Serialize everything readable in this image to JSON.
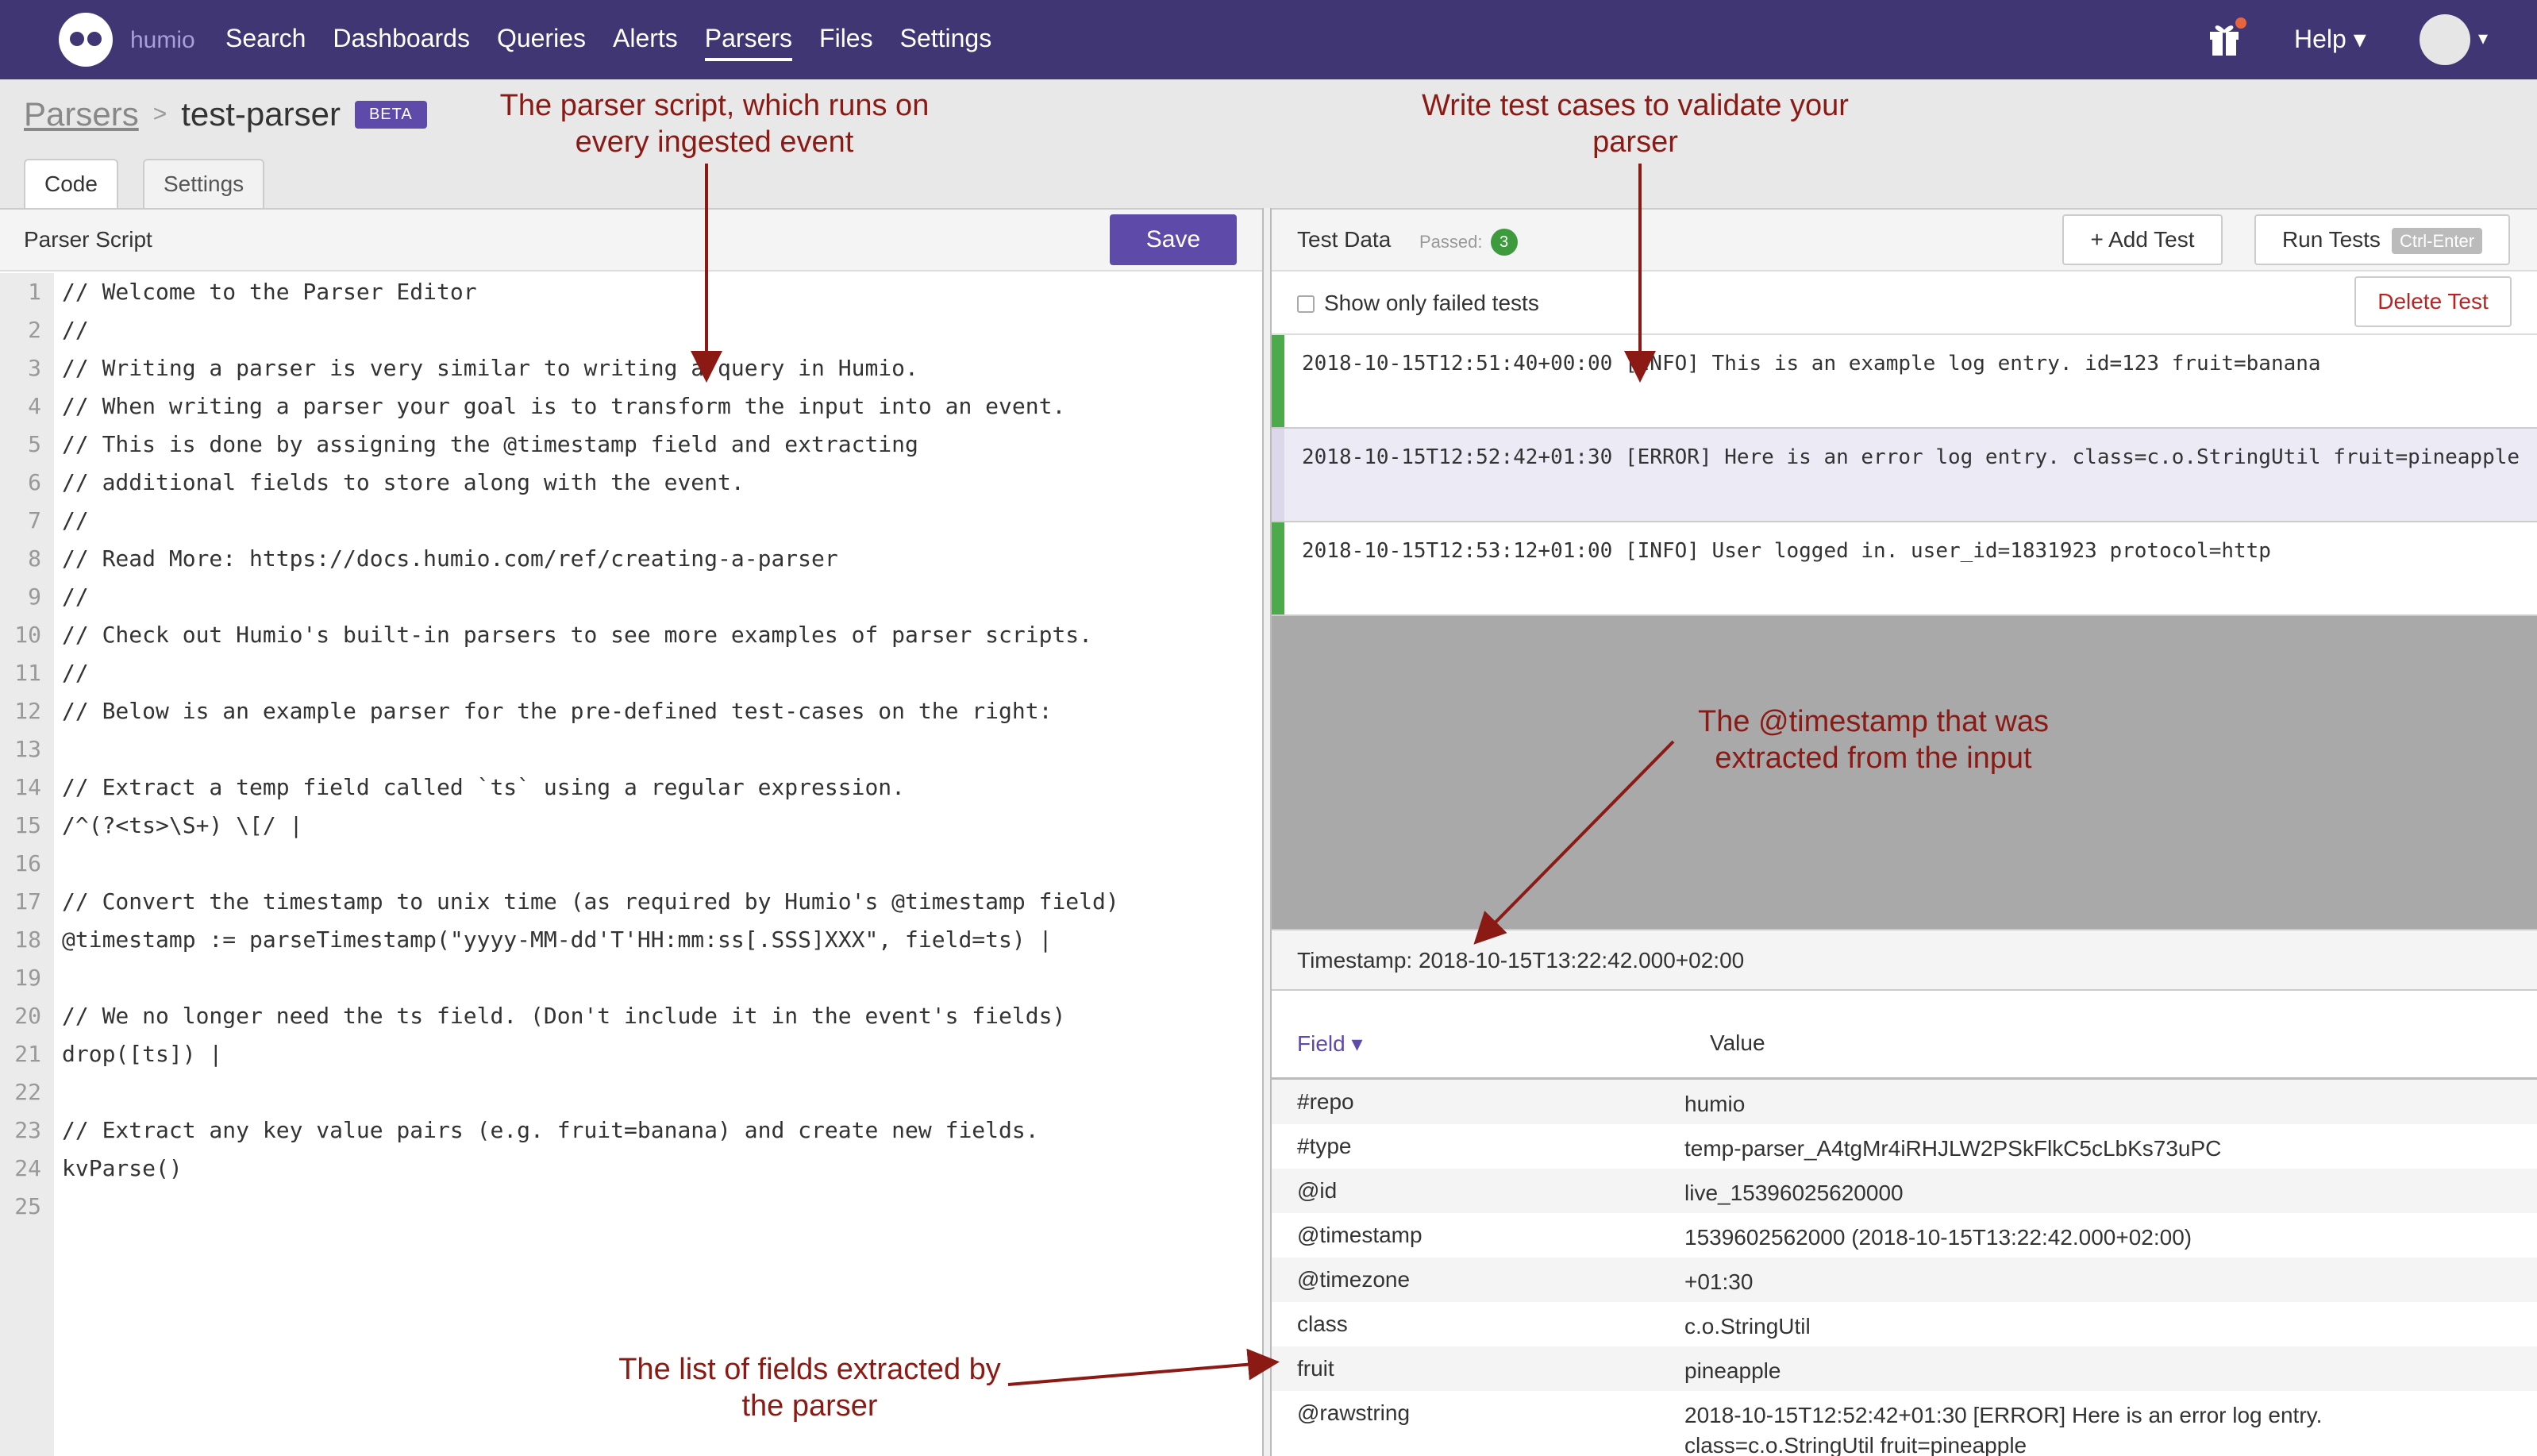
{
  "nav": {
    "brand": "humio",
    "items": [
      {
        "label": "Search"
      },
      {
        "label": "Dashboards"
      },
      {
        "label": "Queries"
      },
      {
        "label": "Alerts"
      },
      {
        "label": "Parsers",
        "active": true
      },
      {
        "label": "Files"
      },
      {
        "label": "Settings"
      }
    ],
    "help_label": "Help ▾",
    "icons": [
      "humio-owl-logo",
      "gift-icon",
      "avatar-icon"
    ]
  },
  "breadcrumb": {
    "parent": "Parsers",
    "separator": ">",
    "current": "test-parser",
    "badge": "BETA"
  },
  "tabs": [
    {
      "label": "Code",
      "active": true
    },
    {
      "label": "Settings",
      "active": false
    }
  ],
  "editor": {
    "title": "Parser Script",
    "save_label": "Save",
    "lines": [
      {
        "n": "1",
        "t": "// Welcome to the Parser Editor",
        "k": "com"
      },
      {
        "n": "2",
        "t": "//",
        "k": "com"
      },
      {
        "n": "3",
        "t": "// Writing a parser is very similar to writing a query in Humio.",
        "k": "com"
      },
      {
        "n": "4",
        "t": "// When writing a parser your goal is to transform the input into an event.",
        "k": "com"
      },
      {
        "n": "5",
        "t": "// This is done by assigning the @timestamp field and extracting",
        "k": "com"
      },
      {
        "n": "6",
        "t": "// additional fields to store along with the event.",
        "k": "com"
      },
      {
        "n": "7",
        "t": "//",
        "k": "com"
      },
      {
        "n": "8",
        "t": "// Read More: https://docs.humio.com/ref/creating-a-parser",
        "k": "com"
      },
      {
        "n": "9",
        "t": "//",
        "k": "com"
      },
      {
        "n": "10",
        "t": "// Check out Humio's built-in parsers to see more examples of parser scripts.",
        "k": "com"
      },
      {
        "n": "11",
        "t": "//",
        "k": "com"
      },
      {
        "n": "12",
        "t": "// Below is an example parser for the pre-defined test-cases on the right:",
        "k": "com"
      },
      {
        "n": "13",
        "t": "",
        "k": "com"
      },
      {
        "n": "14",
        "t": "// Extract a temp field called `ts` using a regular expression.",
        "k": "com"
      },
      {
        "n": "15",
        "t": "/^(?<ts>\\S+) \\[/ |",
        "k": "re"
      },
      {
        "n": "16",
        "t": "",
        "k": "com"
      },
      {
        "n": "17",
        "t": "// Convert the timestamp to unix time (as required by Humio's @timestamp field)",
        "k": "com"
      },
      {
        "n": "18",
        "t": "@timestamp := parseTimestamp(\"yyyy-MM-dd'T'HH:mm:ss[.SSS]XXX\", field=ts) |",
        "k": "fn"
      },
      {
        "n": "19",
        "t": "",
        "k": "com"
      },
      {
        "n": "20",
        "t": "// We no longer need the ts field. (Don't include it in the event's fields)",
        "k": "com"
      },
      {
        "n": "21",
        "t": "drop([ts]) |",
        "k": "fn"
      },
      {
        "n": "22",
        "t": "",
        "k": "com"
      },
      {
        "n": "23",
        "t": "// Extract any key value pairs (e.g. fruit=banana) and create new fields.",
        "k": "com"
      },
      {
        "n": "24",
        "t": "kvParse()",
        "k": "fn"
      },
      {
        "n": "25",
        "t": "",
        "k": "com"
      }
    ]
  },
  "tests": {
    "title": "Test Data",
    "passed_label": "Passed:",
    "passed_count": "3",
    "add_label": "+ Add Test",
    "run_label": "Run Tests",
    "run_shortcut": "Ctrl-Enter",
    "filter_label": "Show only failed tests",
    "delete_label": "Delete Test",
    "cases": [
      {
        "text": "2018-10-15T12:51:40+00:00 [INFO] This is an example log entry. id=123 fruit=banana",
        "selected": false
      },
      {
        "text": "2018-10-15T12:52:42+01:30 [ERROR] Here is an error log entry. class=c.o.StringUtil fruit=pineapple",
        "selected": true
      },
      {
        "text": "2018-10-15T12:53:12+01:00 [INFO] User logged in. user_id=1831923 protocol=http",
        "selected": false
      }
    ]
  },
  "result": {
    "timestamp_label": "Timestamp: 2018-10-15T13:22:42.000+02:00",
    "field_header": "Field ▾",
    "value_header": "Value",
    "fields": [
      {
        "k": "#repo",
        "v": "humio"
      },
      {
        "k": "#type",
        "v": "temp-parser_A4tgMr4iRHJLW2PSkFlkC5cLbKs73uPC"
      },
      {
        "k": "@id",
        "v": "live_15396025620000"
      },
      {
        "k": "@timestamp",
        "v": "1539602562000 (2018-10-15T13:22:42.000+02:00)"
      },
      {
        "k": "@timezone",
        "v": "+01:30"
      },
      {
        "k": "class",
        "v": "c.o.StringUtil"
      },
      {
        "k": "fruit",
        "v": "pineapple"
      },
      {
        "k": "@rawstring",
        "v": "2018-10-15T12:52:42+01:30 [ERROR] Here is an error log entry. class=c.o.StringUtil fruit=pineapple"
      }
    ]
  },
  "annotations": {
    "parser_script": "The parser script, which runs on every ingested event",
    "test_cases": "Write test cases to validate your parser",
    "timestamp": "The @timestamp that was extracted from the input",
    "fields": "The list of fields extracted by the parser"
  },
  "colors": {
    "nav": "#3f3673",
    "accent": "#5e4aa8",
    "annotation": "#8b1a14",
    "pass": "#4caa4c"
  }
}
